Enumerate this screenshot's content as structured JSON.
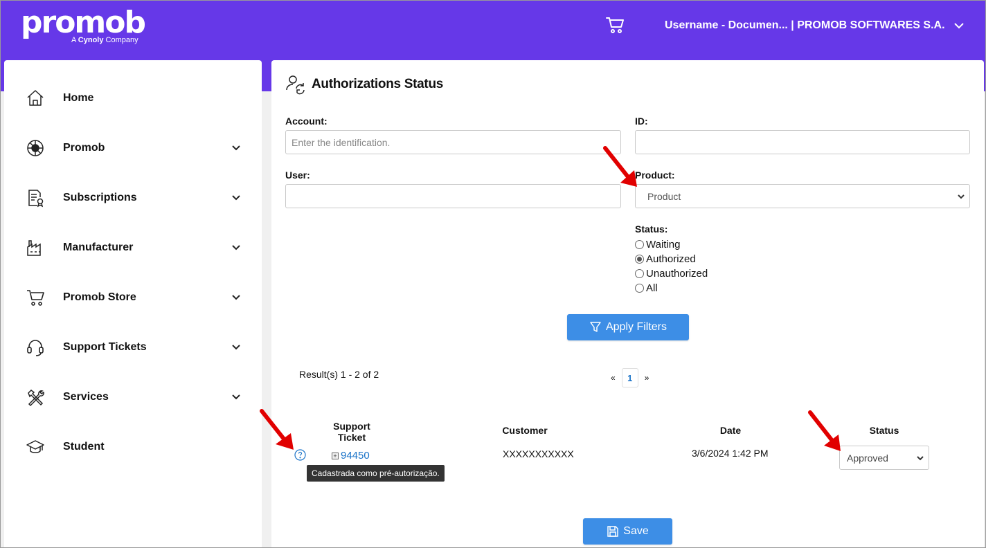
{
  "header": {
    "logo_word": "promob",
    "logo_tag_prefix": "A ",
    "logo_tag_brand": "Cynoly",
    "logo_tag_suffix": " Company",
    "user_label": "Username - Documen... | PROMOB SOFTWARES S.A.",
    "cart_icon": "cart-icon",
    "brand_color": "#6638e8"
  },
  "sidebar": {
    "items": [
      {
        "label": "Home",
        "icon": "home-icon",
        "expandable": false
      },
      {
        "label": "Promob",
        "icon": "promob-logo-icon",
        "expandable": true
      },
      {
        "label": "Subscriptions",
        "icon": "subscription-document-icon",
        "expandable": true
      },
      {
        "label": "Manufacturer",
        "icon": "factory-icon",
        "expandable": true
      },
      {
        "label": "Promob Store",
        "icon": "cart-icon",
        "expandable": true
      },
      {
        "label": "Support Tickets",
        "icon": "headset-icon",
        "expandable": true
      },
      {
        "label": "Services",
        "icon": "tools-icon",
        "expandable": true
      },
      {
        "label": "Student",
        "icon": "graduation-cap-icon",
        "expandable": false
      }
    ]
  },
  "main": {
    "title": "Authorizations Status",
    "filters": {
      "account_label": "Account:",
      "account_placeholder": "Enter the identification.",
      "account_value": "",
      "id_label": "ID:",
      "id_value": "",
      "user_label": "User:",
      "user_value": "",
      "product_label": "Product:",
      "product_selected": "Product",
      "status_label": "Status:",
      "status_options": [
        "Waiting",
        "Authorized",
        "Unauthorized",
        "All"
      ],
      "status_selected": "Authorized",
      "apply_label": "Apply Filters"
    },
    "results_text": "Result(s) 1 - 2 of 2",
    "pager": {
      "prev": "«",
      "current": "1",
      "next": "»"
    },
    "table": {
      "headers": {
        "ticket_line1": "Support",
        "ticket_line2": "Ticket",
        "customer": "Customer",
        "date": "Date",
        "status": "Status"
      },
      "rows": [
        {
          "ticket": "94450",
          "customer": "XXXXXXXXXXX",
          "date": "3/6/2024 1:42 PM",
          "status": "Approved",
          "tooltip": "Cadastrada como pré-autorização."
        }
      ]
    },
    "save_label": "Save",
    "accent_color": "#3d8ee6"
  }
}
